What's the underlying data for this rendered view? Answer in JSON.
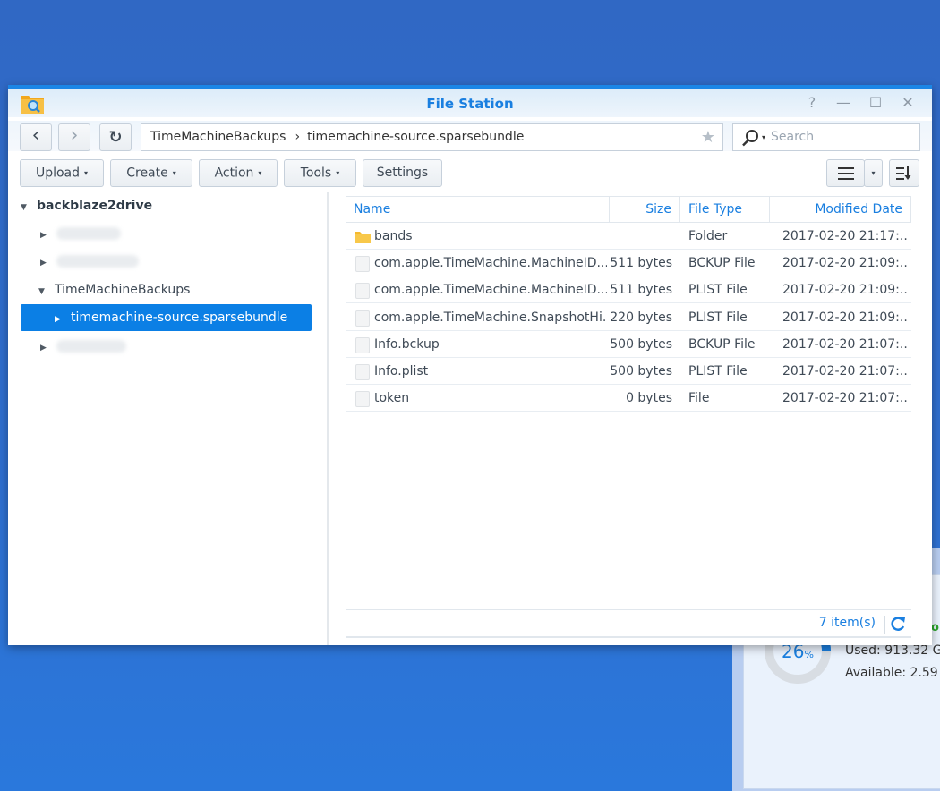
{
  "window": {
    "title": "File Station",
    "controls": {
      "help": "?",
      "minimize": "—",
      "maximize": "☐",
      "close": "✕"
    }
  },
  "navbar": {
    "back_glyph": "‹",
    "forward_glyph": "›",
    "refresh_glyph": "↻",
    "path": [
      "TimeMachineBackups",
      "timemachine-source.sparsebundle"
    ],
    "path_separator": "›",
    "favorite_glyph": "★",
    "search_placeholder": "Search"
  },
  "toolbar": {
    "buttons": [
      {
        "label": "Upload",
        "dropdown": true
      },
      {
        "label": "Create",
        "dropdown": true
      },
      {
        "label": "Action",
        "dropdown": true
      },
      {
        "label": "Tools",
        "dropdown": true
      },
      {
        "label": "Settings",
        "dropdown": false
      }
    ],
    "caret": "▾",
    "view_mode_icon": "list-view-icon",
    "sort_icon": "sort-icon"
  },
  "tree": {
    "root": {
      "label": "backblaze2drive",
      "expanded": true
    },
    "items": [
      {
        "label": "",
        "redacted": true,
        "expanded": false
      },
      {
        "label": "",
        "redacted": true,
        "expanded": false
      },
      {
        "label": "TimeMachineBackups",
        "expanded": true
      },
      {
        "label": "timemachine-source.sparsebundle",
        "expanded": false,
        "selected": true
      },
      {
        "label": "",
        "redacted": true,
        "expanded": false
      }
    ],
    "arrow_collapsed": "▶",
    "arrow_expanded": "▼"
  },
  "file_list": {
    "columns": [
      "Name",
      "Size",
      "File Type",
      "Modified Date"
    ],
    "rows": [
      {
        "name": "bands",
        "size": "",
        "type": "Folder",
        "modified": "2017-02-20 21:17:...",
        "icon": "folder"
      },
      {
        "name": "com.apple.TimeMachine.MachineID....",
        "size": "511 bytes",
        "type": "BCKUP File",
        "modified": "2017-02-20 21:09:...",
        "icon": "file"
      },
      {
        "name": "com.apple.TimeMachine.MachineID....",
        "size": "511 bytes",
        "type": "PLIST File",
        "modified": "2017-02-20 21:09:...",
        "icon": "file"
      },
      {
        "name": "com.apple.TimeMachine.SnapshotHi...",
        "size": "220 bytes",
        "type": "PLIST File",
        "modified": "2017-02-20 21:09:...",
        "icon": "file"
      },
      {
        "name": "Info.bckup",
        "size": "500 bytes",
        "type": "BCKUP File",
        "modified": "2017-02-20 21:07:...",
        "icon": "file"
      },
      {
        "name": "Info.plist",
        "size": "500 bytes",
        "type": "PLIST File",
        "modified": "2017-02-20 21:07:...",
        "icon": "file"
      },
      {
        "name": "token",
        "size": "0 bytes",
        "type": "File",
        "modified": "2017-02-20 21:07:...",
        "icon": "file"
      }
    ],
    "item_count": "7 item(s)"
  },
  "background_widget": {
    "usage_percent": 26,
    "usage_label": "26",
    "percent_sign": "%",
    "used": "Used: 913.32 G",
    "available": "Available: 2.59",
    "status_fragment": "o"
  },
  "colors": {
    "accent": "#1a7fe0",
    "selection": "#0b7fe5",
    "desktop": "#2f6fcf",
    "folder": "#f5b92e"
  }
}
